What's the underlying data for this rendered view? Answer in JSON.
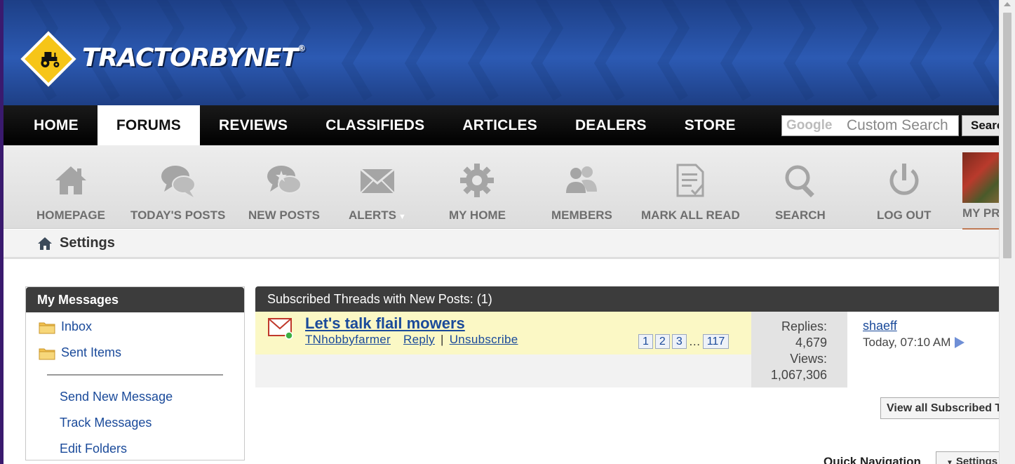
{
  "brand": {
    "name_part1": "TRACTOR",
    "name_part2": "BY",
    "name_part3": "NET",
    "trademark": "®",
    "colors": {
      "banner": "#2c5ab3",
      "logo_yellow": "#f6c518",
      "nav_bg": "#000000",
      "link": "#1a4a9a"
    }
  },
  "topnav": {
    "items": [
      {
        "label": "HOME",
        "active": false
      },
      {
        "label": "FORUMS",
        "active": true
      },
      {
        "label": "REVIEWS",
        "active": false
      },
      {
        "label": "CLASSIFIEDS",
        "active": false
      },
      {
        "label": "ARTICLES",
        "active": false
      },
      {
        "label": "DEALERS",
        "active": false
      },
      {
        "label": "STORE",
        "active": false
      }
    ],
    "search": {
      "brand_text": "Google",
      "placeholder": "Custom Search",
      "button_label": "Search"
    }
  },
  "iconbar": {
    "items": [
      {
        "label": "HOMEPAGE",
        "icon": "house-icon"
      },
      {
        "label": "TODAY'S POSTS",
        "icon": "chat-bubbles-icon"
      },
      {
        "label": "NEW POSTS",
        "icon": "star-chat-icon"
      },
      {
        "label": "ALERTS",
        "icon": "envelope-icon",
        "has_dropdown": true
      },
      {
        "label": "MY HOME",
        "icon": "gear-icon"
      },
      {
        "label": "MEMBERS",
        "icon": "people-icon"
      },
      {
        "label": "MARK ALL READ",
        "icon": "document-check-icon"
      },
      {
        "label": "SEARCH",
        "icon": "magnifier-icon"
      },
      {
        "label": "LOG OUT",
        "icon": "power-icon"
      }
    ],
    "profile_label": "MY PROFILE"
  },
  "breadcrumb": {
    "current": "Settings"
  },
  "sidebar": {
    "title": "My Messages",
    "folders": [
      {
        "label": "Inbox"
      },
      {
        "label": "Sent Items"
      }
    ],
    "links": [
      {
        "label": "Send New Message"
      },
      {
        "label": "Track Messages"
      },
      {
        "label": "Edit Folders"
      }
    ]
  },
  "main": {
    "header": "Subscribed Threads with New Posts: (1)",
    "thread": {
      "title": "Let's talk flail mowers",
      "author": "TNhobbyfarmer",
      "reply_label": "Reply",
      "unsubscribe_label": "Unsubscribe",
      "pages": [
        "1",
        "2",
        "3",
        "117"
      ],
      "ellipsis": "…",
      "replies_label": "Replies:",
      "replies": "4,679",
      "views_label": "Views:",
      "views": "1,067,306",
      "last_poster": "shaeff",
      "last_time": "Today, 07:10 AM"
    },
    "view_all_label": "View all Subscribed Threads",
    "quick_nav_label": "Quick Navigation",
    "quick_nav_selected": "Settings"
  }
}
